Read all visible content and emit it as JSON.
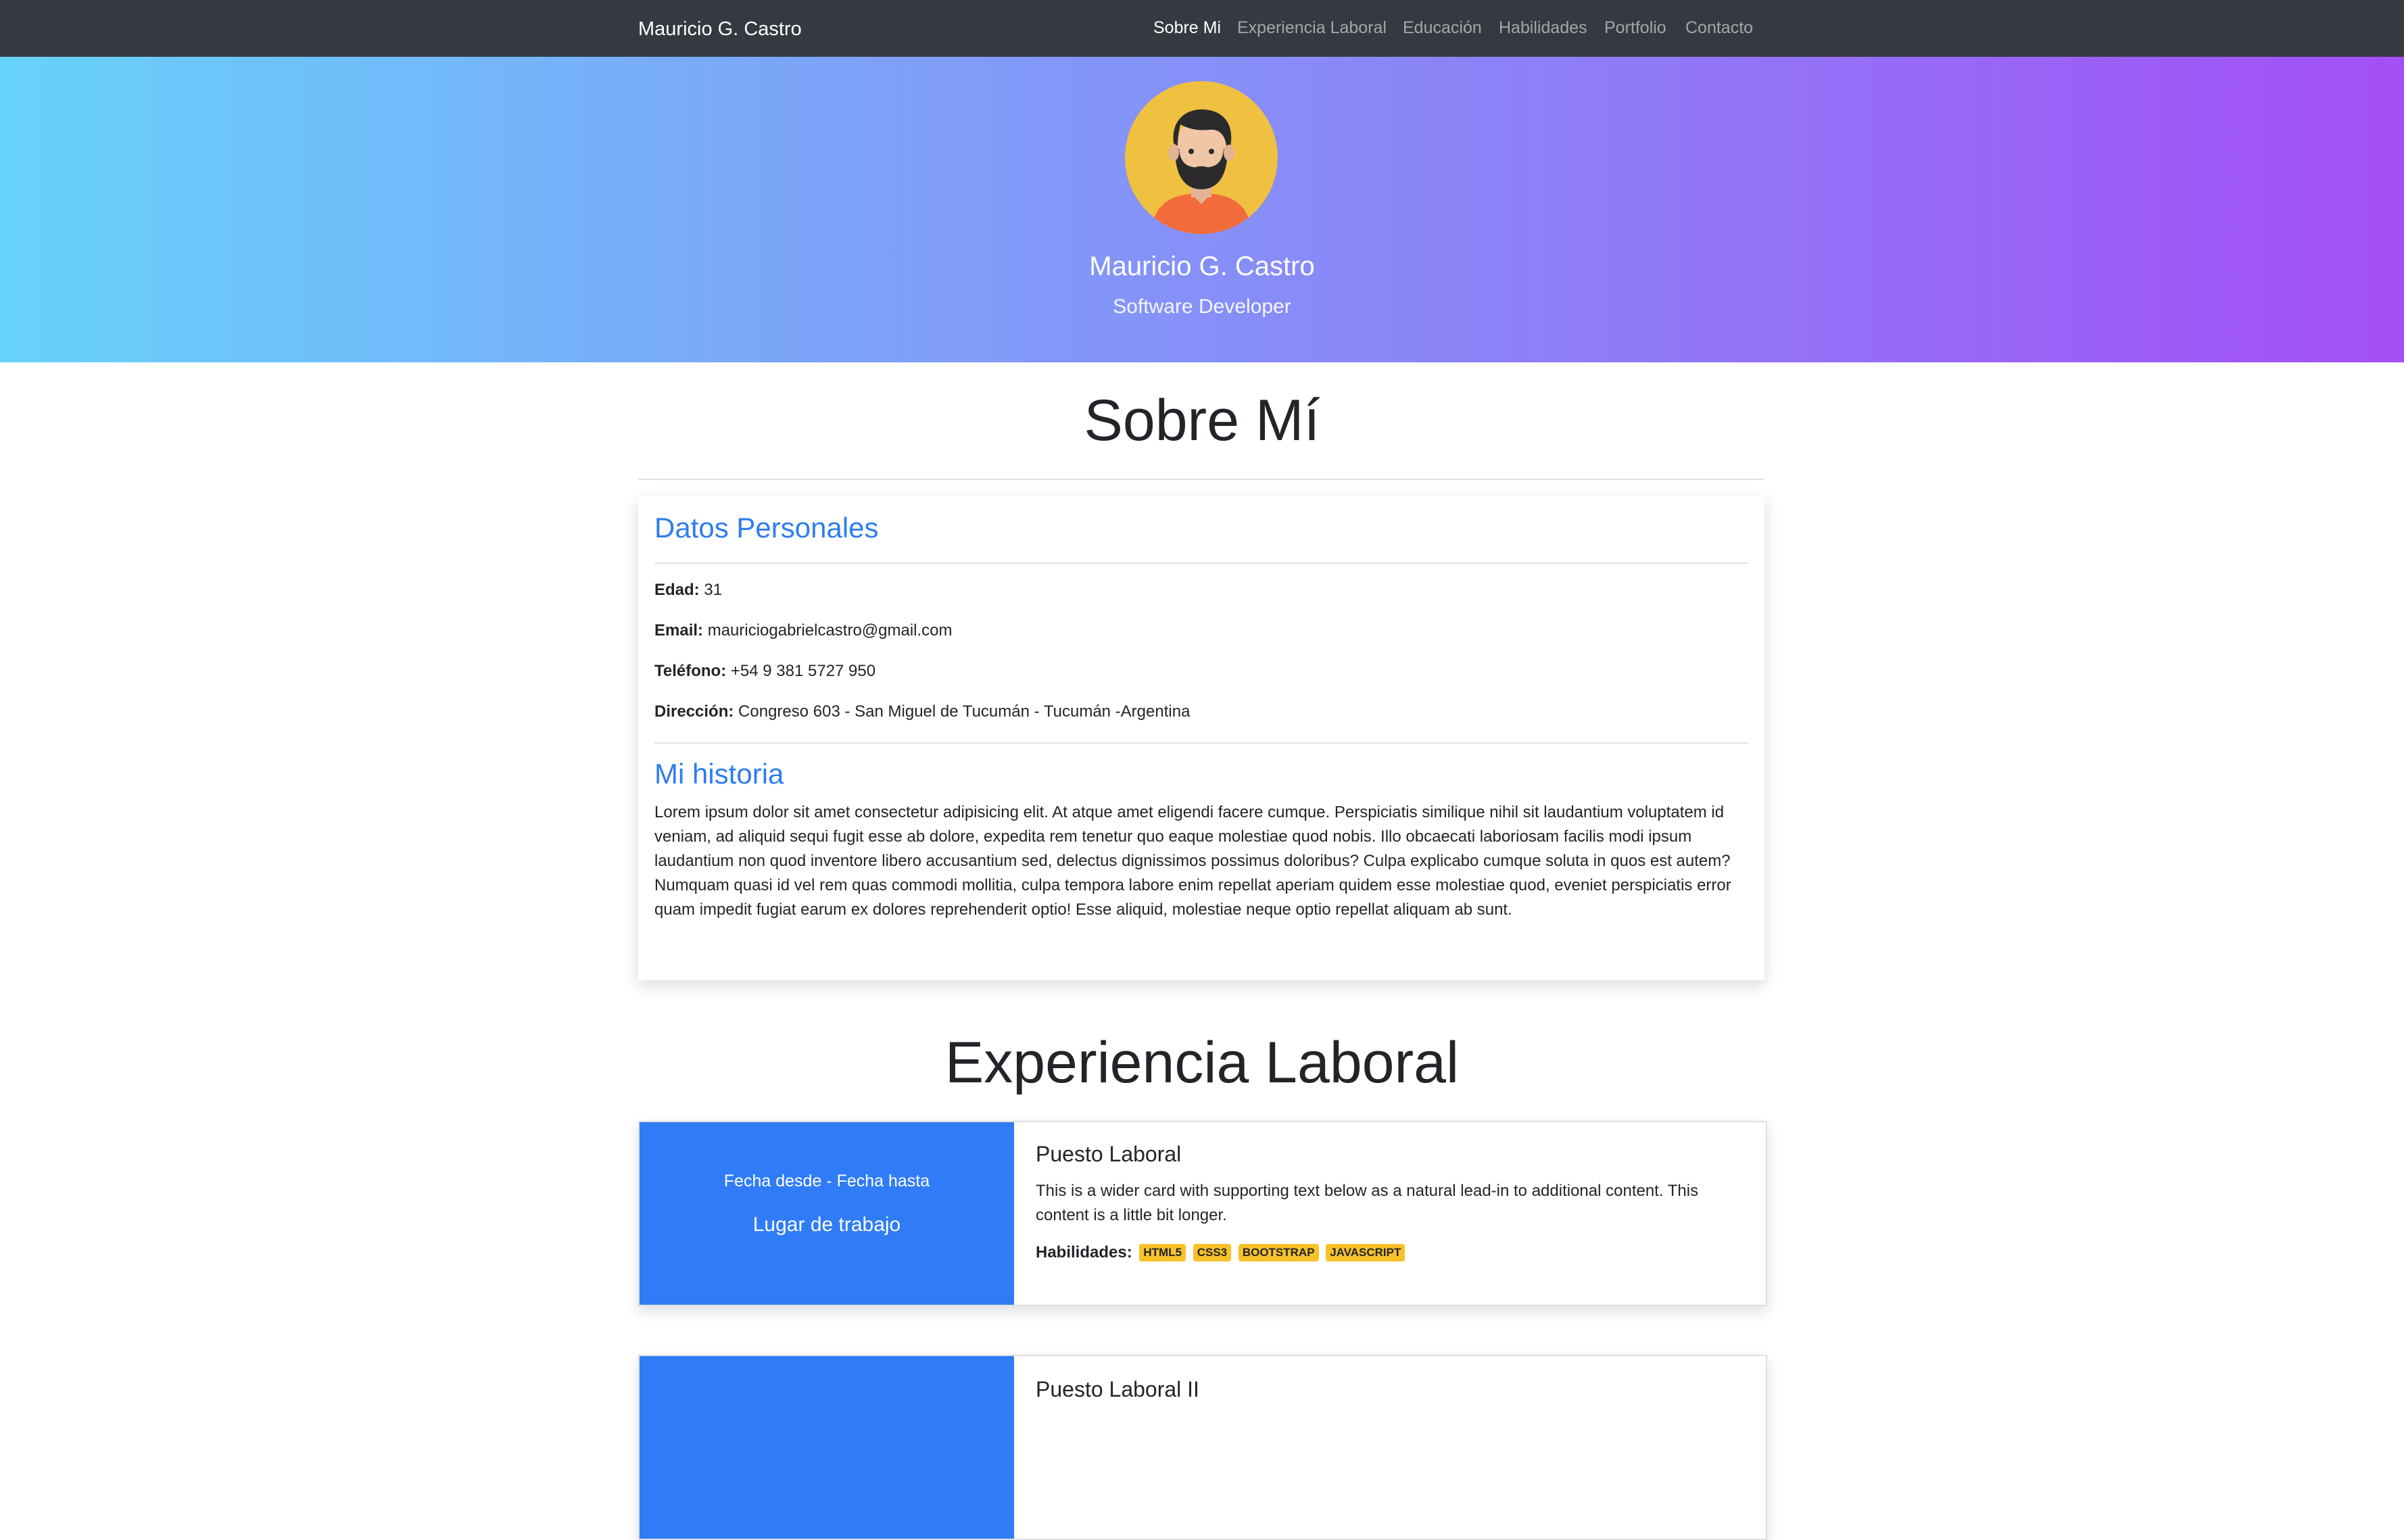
{
  "navbar": {
    "brand": "Mauricio G. Castro",
    "items": [
      {
        "label": "Sobre Mi"
      },
      {
        "label": "Experiencia Laboral"
      },
      {
        "label": "Educación"
      },
      {
        "label": "Habilidades"
      },
      {
        "label": "Portfolio"
      },
      {
        "label": "Contacto"
      }
    ],
    "active": "Sobre Mi"
  },
  "hero": {
    "name": "Mauricio G. Castro",
    "role": "Software Developer",
    "avatar_icon": "user-avatar-icon"
  },
  "about": {
    "title": "Sobre Mí",
    "personal_heading": "Datos Personales",
    "fields": [
      {
        "label": "Edad:",
        "value": " 31"
      },
      {
        "label": "Email:",
        "value": " mauriciogabrielcastro@gmail.com"
      },
      {
        "label": "Teléfono:",
        "value": " +54 9 381 5727 950"
      },
      {
        "label": "Dirección:",
        "value": " Congreso 603 - San Miguel de Tucumán - Tucumán -Argentina"
      }
    ],
    "history_heading": "Mi historia",
    "history_text": "Lorem ipsum dolor sit amet consectetur adipisicing elit. At atque amet eligendi facere cumque. Perspiciatis similique nihil sit laudantium voluptatem id veniam, ad aliquid sequi fugit esse ab dolore, expedita rem tenetur quo eaque molestiae quod nobis. Illo obcaecati laboriosam facilis modi ipsum laudantium non quod inventore libero accusantium sed, delectus dignissimos possimus doloribus? Culpa explicabo cumque soluta in quos est autem? Numquam quasi id vel rem quas commodi mollitia, culpa tempora labore enim repellat aperiam quidem esse molestiae quod, eveniet perspiciatis error quam impedit fugiat earum ex dolores reprehenderit optio! Esse aliquid, molestiae neque optio repellat aliquam ab sunt."
  },
  "experience": {
    "title": "Experiencia Laboral",
    "jobs": [
      {
        "dates": "Fecha desde - Fecha hasta",
        "place": "Lugar de trabajo",
        "position": "Puesto Laboral",
        "text": "This is a wider card with supporting text below as a natural lead-in to additional content. This content is a little bit longer.",
        "skills_label": "Habilidades:",
        "skills": [
          "HTML5",
          "CSS3",
          "BOOTSTRAP",
          "JAVASCRIPT"
        ]
      },
      {
        "position": "Puesto Laboral II"
      }
    ]
  },
  "colors": {
    "navbar_bg": "#343a40",
    "accent_blue": "#2f7cf6",
    "heading_blue": "#2e7df0",
    "badge_yellow": "#f7c12a",
    "gradient_start": "#67d2fb",
    "gradient_end": "#a34ff6"
  }
}
